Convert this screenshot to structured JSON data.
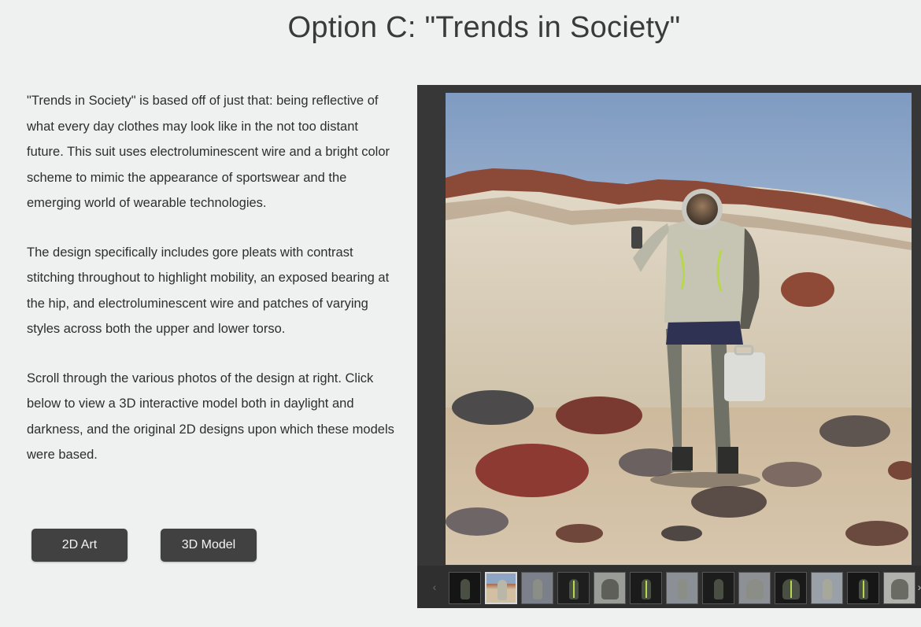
{
  "page": {
    "title": "Option C: \"Trends in Society\""
  },
  "description": {
    "paragraphs": [
      "\"Trends in Society\" is based off of just that: being reflective of what every day clothes may look like in the not too distant future. This suit uses electroluminescent wire and a bright color scheme to mimic the appearance of sportswear and the emerging world of wearable technologies.",
      "The design specifically includes gore pleats with contrast stitching throughout to highlight mobility, an exposed bearing at the hip, and electroluminescent wire and patches of varying styles across both the upper and lower torso.",
      "Scroll through the various photos of the design at right. Click below to view a 3D interactive model both in daylight and darkness, and the original 2D designs upon which these models were based."
    ]
  },
  "buttons": {
    "art_2d": "2D Art",
    "model_3d": "3D Model"
  },
  "gallery": {
    "prev_arrow": "‹",
    "next_arrow": "›",
    "thumbnail_count": 13,
    "active_thumbnail": 2,
    "main_image_icon": "astronaut-desert-photo",
    "colors": {
      "frame": "#373737",
      "strip": "#2f2f2f",
      "button": "#414141",
      "suit_accent": "#b6d84a"
    }
  }
}
